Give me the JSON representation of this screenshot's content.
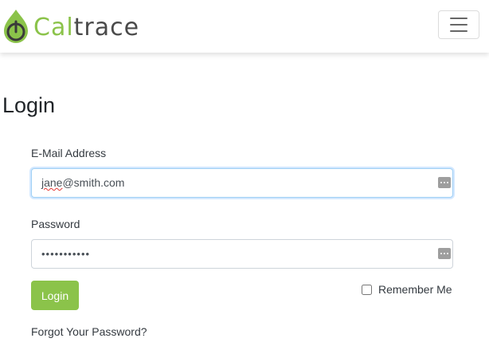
{
  "brand": {
    "name_part1": "Cal",
    "name_part2": "trace",
    "accent_color": "#8bc34a",
    "text_color": "#4a4a4a"
  },
  "navbar": {
    "toggler_icon": "hamburger-menu-icon"
  },
  "page": {
    "title": "Login"
  },
  "form": {
    "email_label": "E-Mail Address",
    "email_value_misspelled": "jane",
    "email_value_rest": "@smith.com",
    "password_label": "Password",
    "password_value": "•••••••••••",
    "login_button": "Login",
    "remember_label": "Remember Me",
    "remember_checked": false,
    "forgot_link": "Forgot Your Password?"
  }
}
